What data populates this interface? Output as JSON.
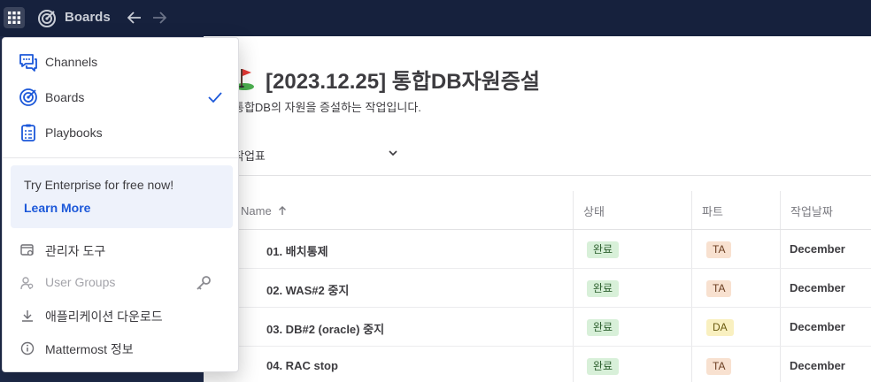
{
  "topbar": {
    "product_name": "Boards",
    "icons": [
      "apps-grid-icon",
      "boards-target-icon",
      "back-arrow-icon",
      "forward-arrow-icon"
    ]
  },
  "menu": {
    "items": [
      {
        "label": "Channels",
        "icon": "channels-icon"
      },
      {
        "label": "Boards",
        "icon": "boards-icon",
        "selected": true
      },
      {
        "label": "Playbooks",
        "icon": "playbooks-icon"
      }
    ],
    "promo": {
      "text": "Try Enterprise for free now!",
      "link": "Learn More"
    },
    "sub_items": [
      {
        "label": "관리자 도구",
        "icon": "admin-console-icon"
      },
      {
        "label": "User Groups",
        "icon": "user-groups-icon",
        "disabled": true
      },
      {
        "label": "애플리케이션 다운로드",
        "icon": "download-icon"
      },
      {
        "label": "Mattermost 정보",
        "icon": "info-icon"
      }
    ]
  },
  "board": {
    "title": "[2023.12.25] 통합DB자원증설",
    "description": "통합DB의 자원을 증설하는 작업입니다.",
    "view_name": "작업표"
  },
  "table": {
    "headers": {
      "name": "Name",
      "status": "상태",
      "part": "파트",
      "date": "작업날짜"
    },
    "rows": [
      {
        "name": "01. 배치통제",
        "status": "완료",
        "part": "TA",
        "date": "December"
      },
      {
        "name": "02. WAS#2 중지",
        "status": "완료",
        "part": "TA",
        "date": "December"
      },
      {
        "name": "03. DB#2 (oracle) 중지",
        "status": "완료",
        "part": "DA",
        "date": "December"
      },
      {
        "name": "04. RAC stop",
        "status": "완료",
        "part": "TA",
        "date": "December"
      }
    ]
  },
  "colors": {
    "topbar": "#16213d",
    "sidebar": "#1e2a4a",
    "accent": "#1c58d9",
    "status_done_bg": "#d8f0d9",
    "part_ta_bg": "#f8e1d0",
    "part_da_bg": "#f9f0c0"
  }
}
